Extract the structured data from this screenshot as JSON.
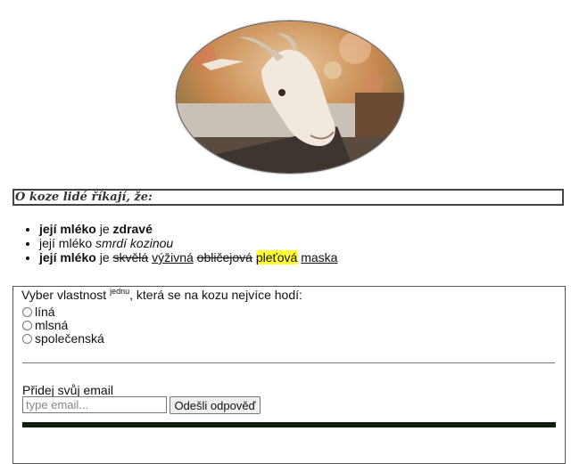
{
  "image": {
    "alt": "koza"
  },
  "heading": "O koze lidé říkají, že:",
  "facts": [
    {
      "parts": [
        {
          "text": "její ",
          "style": "b"
        },
        {
          "text": "mléko",
          "style": "b"
        },
        {
          "text": " je ",
          "style": "n"
        },
        {
          "text": "zdravé",
          "style": "b"
        }
      ]
    },
    {
      "parts": [
        {
          "text": "její ",
          "style": "n"
        },
        {
          "text": "mléko ",
          "style": "n"
        },
        {
          "text": "smrdí kozinou",
          "style": "i"
        }
      ]
    },
    {
      "parts": [
        {
          "text": "její mléko",
          "style": "b"
        },
        {
          "text": " je ",
          "style": "n"
        },
        {
          "text": "skvělá",
          "style": "s"
        },
        {
          "text": " ",
          "style": "n"
        },
        {
          "text": "výživná",
          "style": "u"
        },
        {
          "text": " ",
          "style": "n"
        },
        {
          "text": "obličejová",
          "style": "s"
        },
        {
          "text": " ",
          "style": "n"
        },
        {
          "text": "pleťová",
          "style": "hl"
        },
        {
          "text": " ",
          "style": "n"
        },
        {
          "text": "maska",
          "style": "u"
        }
      ]
    }
  ],
  "survey": {
    "legend_before": "Vyber vlastnost ",
    "legend_sup": "jednu",
    "legend_after": ", která se na kozu nejvíce hodí:",
    "options": [
      "líná",
      "mlsná",
      "společenská"
    ],
    "email_label": "Přidej svůj email",
    "email_placeholder": "type email...",
    "email_value": "",
    "submit_label": "Odešli odpověď"
  },
  "colors": {
    "highlight": "#ffff33",
    "dark_bar": "#0f1f0c"
  }
}
